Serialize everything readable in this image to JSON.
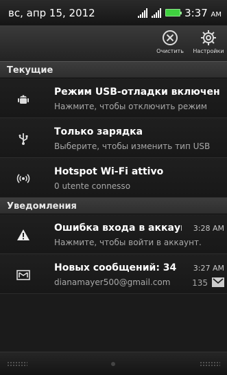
{
  "status_bar": {
    "date": "вс, апр 15, 2012",
    "time": "3:37",
    "time_suffix": "AM",
    "battery_color": "#3fd23f"
  },
  "action_bar": {
    "clear_label": "Очистить",
    "clear_icon": "close-circle-icon",
    "settings_label": "Настройки",
    "settings_icon": "gear-icon"
  },
  "sections": {
    "current_header": "Текущие",
    "notifications_header": "Уведомления"
  },
  "current": [
    {
      "icon": "android-debug-icon",
      "title": "Режим USB-отладки включен",
      "subtitle": "Нажмите, чтобы отключить режим"
    },
    {
      "icon": "usb-icon",
      "title": "Только зарядка",
      "subtitle": "Выберите, чтобы изменить тип USB"
    },
    {
      "icon": "hotspot-icon",
      "title": "Hotspot Wi-Fi attivo",
      "subtitle": "0 utente connesso"
    }
  ],
  "notifications": [
    {
      "icon": "warning-icon",
      "title": "Ошибка входа в аккаунт",
      "subtitle": "Нажмите, чтобы войти в аккаунт.",
      "time": "3:28 AM"
    },
    {
      "icon": "mail-icon",
      "title": "Новых сообщений: 34",
      "subtitle": "dianamayer500@gmail.com",
      "time": "3:27 AM",
      "count": "135"
    }
  ]
}
